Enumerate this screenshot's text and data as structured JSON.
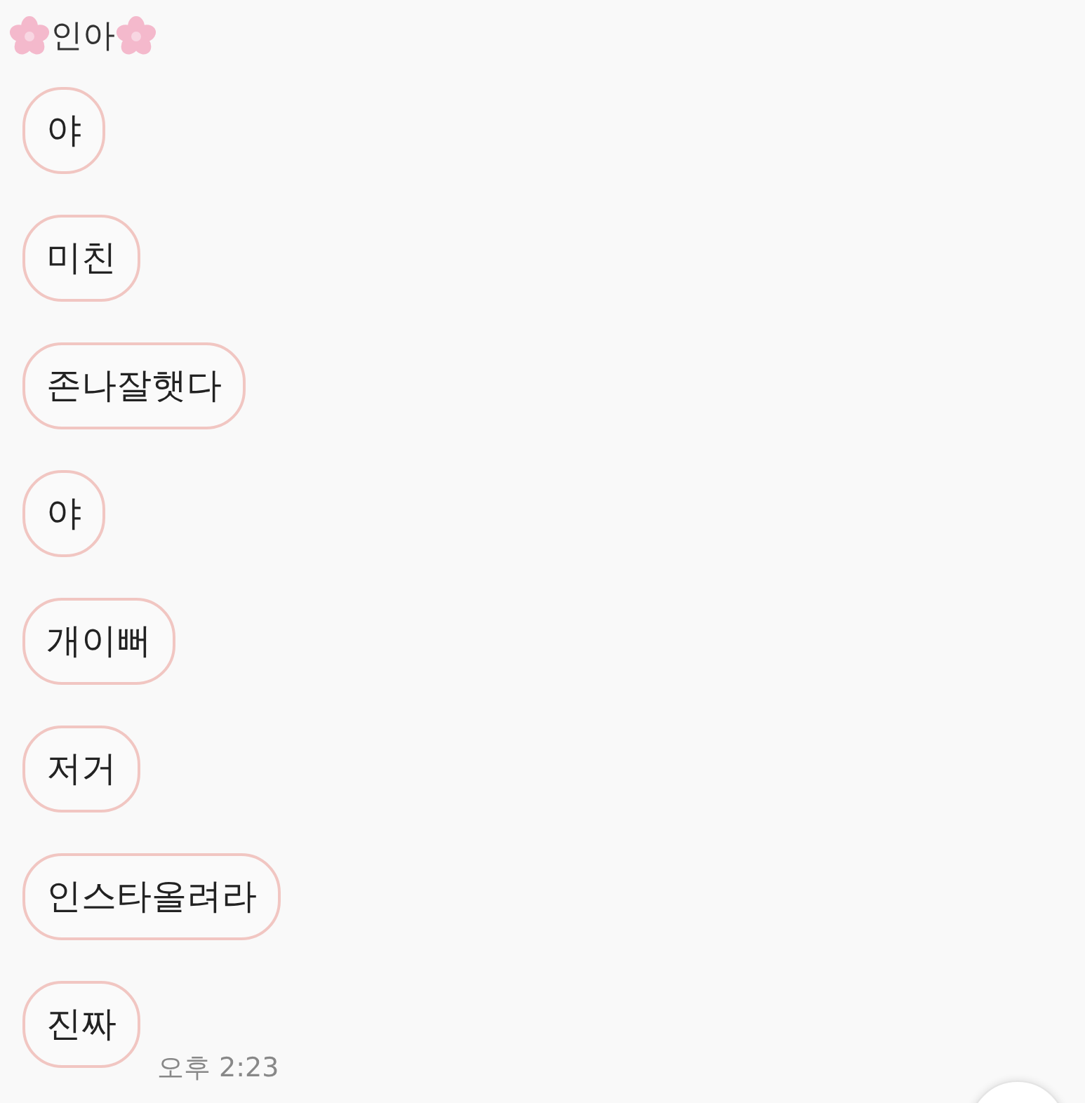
{
  "sender": {
    "name": "인아"
  },
  "messages": [
    {
      "text": "야"
    },
    {
      "text": "미친"
    },
    {
      "text": "존나잘햇다"
    },
    {
      "text": "야"
    },
    {
      "text": "개이뻐"
    },
    {
      "text": "저거"
    },
    {
      "text": "인스타올려라"
    },
    {
      "text": "진짜",
      "time": "오후 2:23"
    }
  ]
}
